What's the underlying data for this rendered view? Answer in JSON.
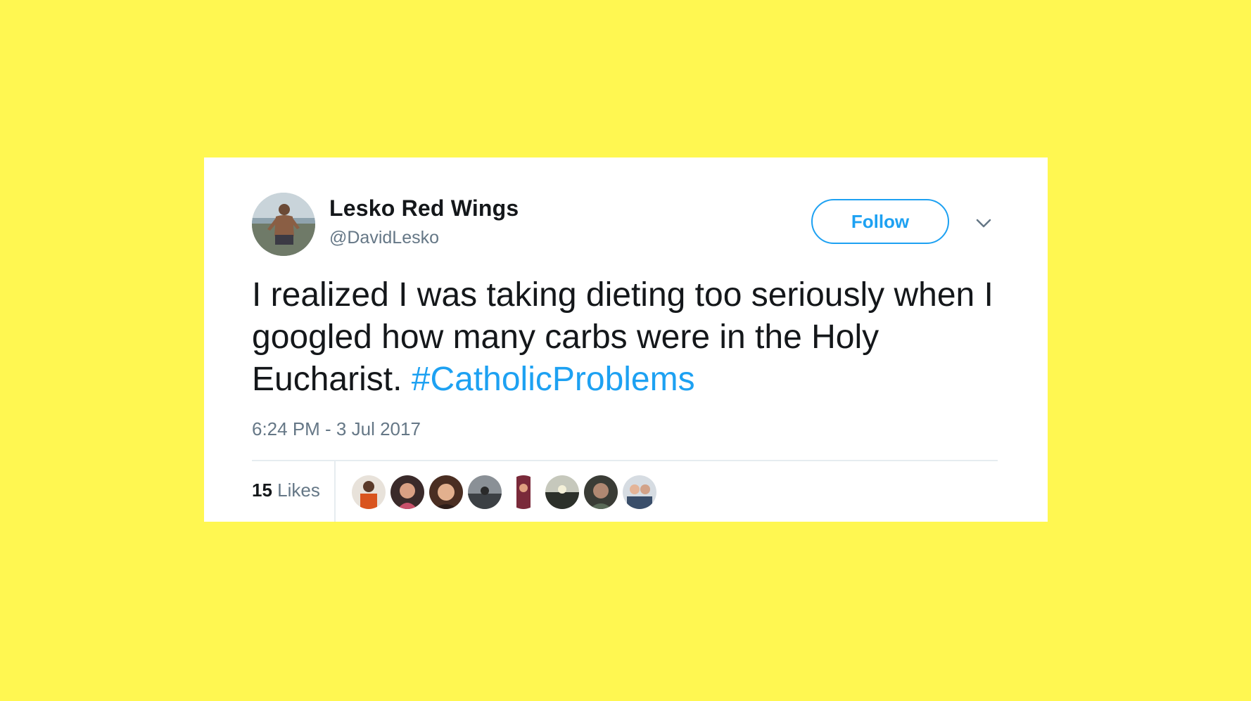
{
  "tweet": {
    "user": {
      "display_name": "Lesko Red Wings",
      "handle": "@DavidLesko"
    },
    "follow_label": "Follow",
    "text": "I realized I was taking dieting too seriously when I googled how many carbs were in the Holy Eucharist.",
    "hashtag": "#CatholicProblems",
    "timestamp": "6:24 PM - 3 Jul 2017",
    "likes": {
      "count": "15",
      "label": "Likes"
    },
    "liker_avatars": [
      {
        "icon": "liker-avatar-1",
        "color": "#c8501e"
      },
      {
        "icon": "liker-avatar-2",
        "color": "#7a4a3c"
      },
      {
        "icon": "liker-avatar-3",
        "color": "#b07a5a"
      },
      {
        "icon": "liker-avatar-4",
        "color": "#6a6e72"
      },
      {
        "icon": "liker-avatar-5",
        "color": "#8a3a4a"
      },
      {
        "icon": "liker-avatar-6",
        "color": "#4a5248"
      },
      {
        "icon": "liker-avatar-7",
        "color": "#5a5048"
      },
      {
        "icon": "liker-avatar-8",
        "color": "#7f8a96"
      }
    ]
  },
  "colors": {
    "background": "#fff751",
    "link": "#1da1f2",
    "text": "#14171a",
    "muted": "#657786"
  }
}
